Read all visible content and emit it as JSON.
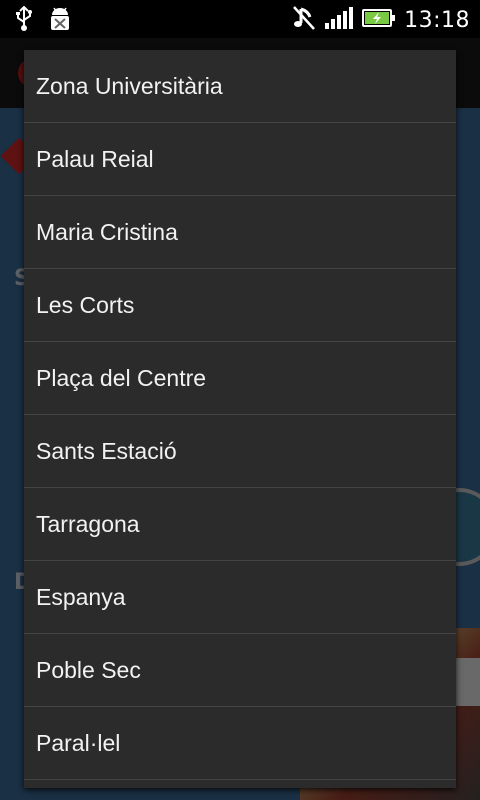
{
  "status_bar": {
    "time": "13:18",
    "icons": [
      "usb-icon",
      "android-debug-icon",
      "music-muted-icon",
      "signal-icon",
      "battery-charging-icon"
    ]
  },
  "station_list": {
    "items": [
      "Zona Universitària",
      "Palau Reial",
      "Maria Cristina",
      "Les Corts",
      "Plaça del Centre",
      "Sants Estació",
      "Tarragona",
      "Espanya",
      "Poble Sec",
      "Paral·lel"
    ]
  },
  "background": {
    "partial_letters": [
      "S",
      "D"
    ]
  },
  "colors": {
    "status_bar_bg": "#000000",
    "dropdown_bg": "#2b2b2b",
    "divider": "#444444",
    "text": "#f2f2f2",
    "battery_green": "#7ac943"
  }
}
